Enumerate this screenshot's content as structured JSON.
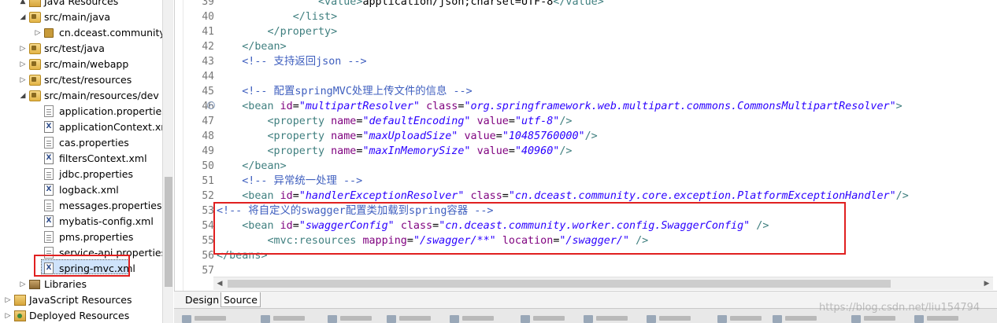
{
  "project_tree": {
    "items": [
      {
        "label": "Java Resources",
        "twisty": "▲",
        "icon": "java-resources-icon"
      },
      {
        "label": "src/main/java",
        "twisty": "◢",
        "icon": "source-folder-icon"
      },
      {
        "label": "cn.dceast.community.w",
        "twisty": "▷",
        "icon": "package-icon"
      },
      {
        "label": "src/test/java",
        "twisty": "▷",
        "icon": "source-folder-icon"
      },
      {
        "label": "src/main/webapp",
        "twisty": "▷",
        "icon": "source-folder-icon"
      },
      {
        "label": "src/test/resources",
        "twisty": "▷",
        "icon": "source-folder-icon"
      },
      {
        "label": "src/main/resources/dev",
        "twisty": "◢",
        "icon": "source-folder-icon"
      },
      {
        "label": "application.properties",
        "icon": "properties-file-icon"
      },
      {
        "label": "applicationContext.xml",
        "icon": "xml-file-icon"
      },
      {
        "label": "cas.properties",
        "icon": "properties-file-icon"
      },
      {
        "label": "filtersContext.xml",
        "icon": "xml-file-icon"
      },
      {
        "label": "jdbc.properties",
        "icon": "properties-file-icon"
      },
      {
        "label": "logback.xml",
        "icon": "xml-file-icon"
      },
      {
        "label": "messages.properties",
        "icon": "properties-file-icon"
      },
      {
        "label": "mybatis-config.xml",
        "icon": "xml-file-icon"
      },
      {
        "label": "pms.properties",
        "icon": "properties-file-icon"
      },
      {
        "label": "service-api.properties",
        "icon": "properties-file-icon"
      },
      {
        "label": "spring-mvc.xml",
        "icon": "xml-file-icon"
      },
      {
        "label": "Libraries",
        "twisty": "▷",
        "icon": "library-icon"
      },
      {
        "label": "JavaScript Resources",
        "twisty": "▷",
        "icon": "javascript-resources-icon"
      },
      {
        "label": "Deployed Resources",
        "twisty": "▷",
        "icon": "deployed-resources-icon"
      }
    ],
    "selected": "spring-mvc.xml"
  },
  "editor": {
    "line_numbers": [
      "39",
      "40",
      "41",
      "42",
      "43",
      "44",
      "45",
      "46",
      "47",
      "48",
      "49",
      "50",
      "51",
      "52",
      "53",
      "54",
      "55",
      "56",
      "57"
    ],
    "lines": [
      {
        "text": "                <value>application/json;charset=UTF-8</value>"
      },
      {
        "text": "            </list>"
      },
      {
        "text": "        </property>"
      },
      {
        "text": "    </bean>"
      },
      {
        "text": "    <!-- 支持返回json -->"
      },
      {
        "text": ""
      },
      {
        "text": "    <!-- 配置springMVC处理上传文件的信息 -->"
      },
      {
        "text": "    <bean id=\"multipartResolver\" class=\"org.springframework.web.multipart.commons.CommonsMultipartResolver\">"
      },
      {
        "text": "        <property name=\"defaultEncoding\" value=\"utf-8\"/>"
      },
      {
        "text": "        <property name=\"maxUploadSize\" value=\"10485760000\"/>"
      },
      {
        "text": "        <property name=\"maxInMemorySize\" value=\"40960\"/>"
      },
      {
        "text": "    </bean>"
      },
      {
        "text": "    <!-- 异常统一处理 -->"
      },
      {
        "text": "    <bean id=\"handlerExceptionResolver\" class=\"cn.dceast.community.core.exception.PlatformExceptionHandler\"/>"
      },
      {
        "text": "<!-- 将自定义的swagger配置类加载到spring容器 -->"
      },
      {
        "text": "    <bean id=\"swaggerConfig\" class=\"cn.dceast.community.worker.config.SwaggerConfig\" />"
      },
      {
        "text": "        <mvc:resources mapping=\"/swagger/**\" location=\"/swagger/\" />"
      },
      {
        "text": "</beans>"
      },
      {
        "text": ""
      }
    ]
  },
  "editor_tabs": {
    "design": "Design",
    "source": "Source",
    "active": "Source"
  },
  "watermark": "https://blog.csdn.net/liu154794",
  "colors": {
    "highlight_box": "#e02020",
    "xml_tag": "#3f7f7f",
    "xml_attr_name": "#7f007f",
    "xml_attr_value": "#2a00ff",
    "xml_comment": "#3f5fbf"
  }
}
